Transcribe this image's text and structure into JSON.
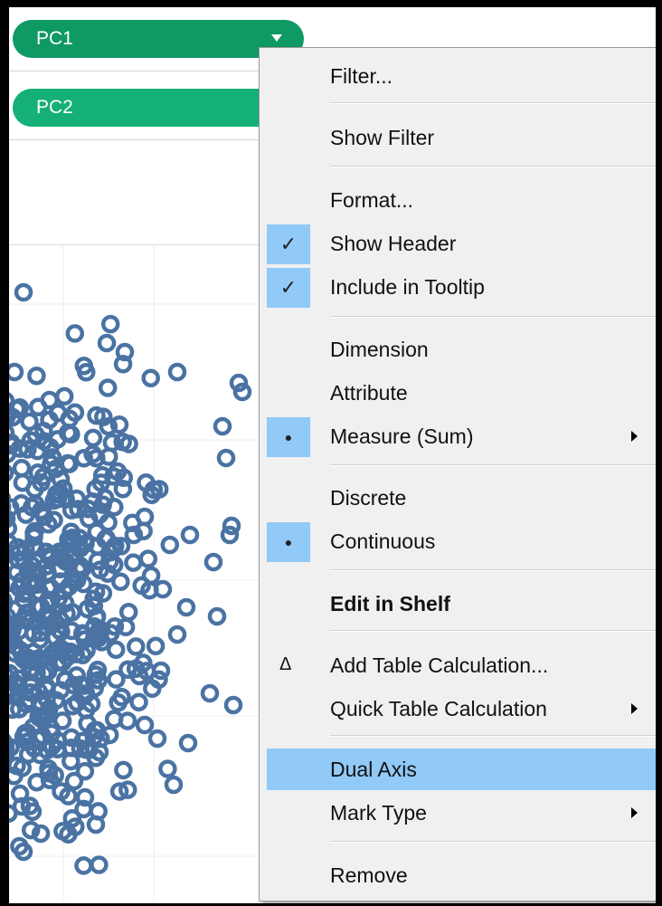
{
  "shelves": {
    "pill1": "PC1",
    "pill2": "PC2"
  },
  "menu": {
    "items": [
      {
        "label": "Filter..."
      },
      {
        "label": "Show Filter"
      },
      {
        "label": "Format..."
      },
      {
        "label": "Show Header",
        "checked": true
      },
      {
        "label": "Include in Tooltip",
        "checked": true
      },
      {
        "label": "Dimension"
      },
      {
        "label": "Attribute"
      },
      {
        "label": "Measure (Sum)",
        "selected": true,
        "submenu": true
      },
      {
        "label": "Discrete"
      },
      {
        "label": "Continuous",
        "selected": true
      },
      {
        "label": "Edit in Shelf",
        "bold": true
      },
      {
        "label": "Add Table Calculation...",
        "icon": "delta-icon"
      },
      {
        "label": "Quick Table Calculation",
        "submenu": true
      },
      {
        "label": "Dual Axis",
        "highlighted": true
      },
      {
        "label": "Mark Type",
        "submenu": true
      },
      {
        "label": "Remove"
      }
    ],
    "glyphs": {
      "check": "✓",
      "dot": "●",
      "delta": "Δ"
    }
  },
  "colors": {
    "pill": "#0f9963",
    "mark": "#4a73a3",
    "menu_highlight": "#91c9f7"
  }
}
